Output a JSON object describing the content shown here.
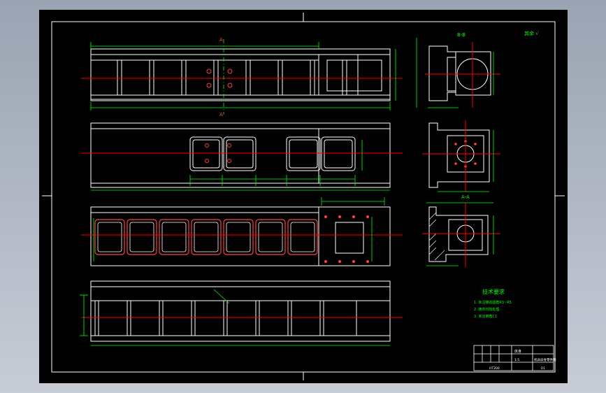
{
  "sheet": {
    "paper_color": "#000000",
    "frame_color": "#ffffff",
    "outline_color": "#ffffff",
    "dim_color": "#00ff00",
    "center_color": "#ff0000",
    "hatch_color": "#ffffff"
  },
  "labels": {
    "section_a_top": "A",
    "section_a_bottom": "A",
    "side_view_title": "B-B",
    "section_view_title": "A-A",
    "roughness_note": "其余 √",
    "tech_title": "技术要求"
  },
  "tech_requirements": [
    "1. 未注铸造圆角R3~R5",
    "2. 铸件时效处理",
    "3. 未注倒角C1"
  ],
  "title_block": {
    "part_name": "床身",
    "drawing_title": "机床床身零件图",
    "scale": "1:5",
    "material": "HT200",
    "sheet_no": "01"
  }
}
